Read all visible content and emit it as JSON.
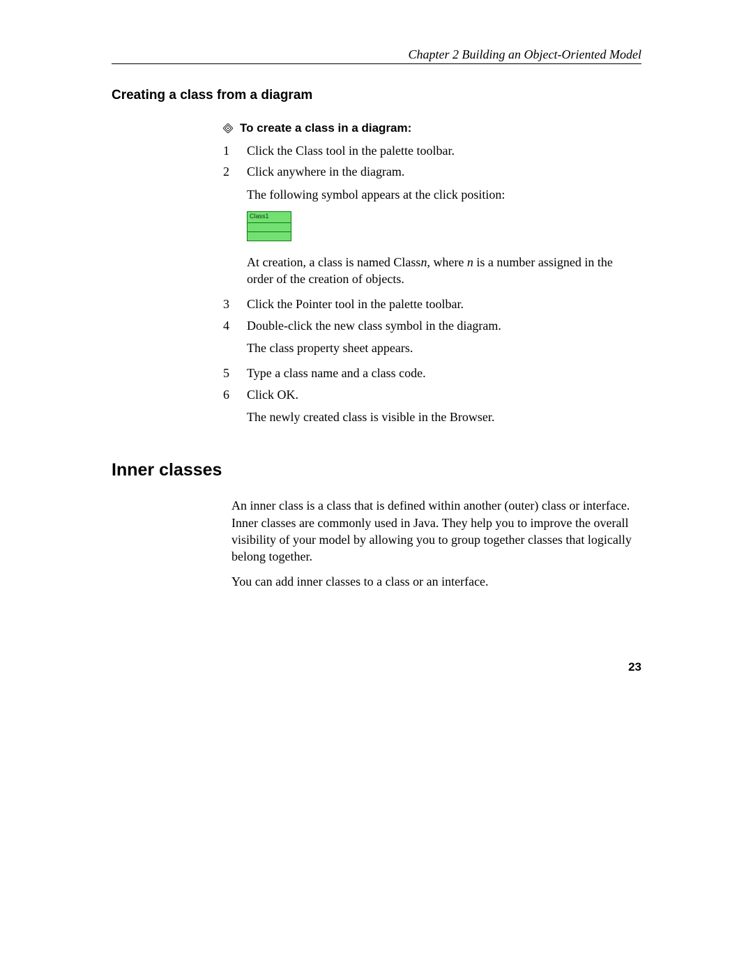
{
  "header": "Chapter 2  Building an Object-Oriented Model",
  "section_heading": "Creating a class from a diagram",
  "proc_title": "To create a class in a diagram:",
  "steps": {
    "s1": {
      "num": "1",
      "text": "Click the Class tool in the palette toolbar."
    },
    "s2": {
      "num": "2",
      "text": "Click anywhere in the diagram."
    },
    "s2_note1": "The following symbol appears at the click position:",
    "class_label": "Class1",
    "s2_note2_a": "At creation, a class is named Class",
    "s2_note2_b": "n",
    "s2_note2_c": ", where ",
    "s2_note2_d": "n",
    "s2_note2_e": " is a number assigned in the order of the creation of objects.",
    "s3": {
      "num": "3",
      "text": "Click the Pointer tool in the palette toolbar."
    },
    "s4": {
      "num": "4",
      "text": "Double-click the new class symbol in the diagram."
    },
    "s4_note": "The class property sheet appears.",
    "s5": {
      "num": "5",
      "text": "Type a class name and a class code."
    },
    "s6": {
      "num": "6",
      "text": "Click OK."
    },
    "s6_note": "The newly created class is visible in the Browser."
  },
  "h2": "Inner classes",
  "inner_para1": "An inner class is a class that is defined within another (outer) class or interface. Inner classes are commonly used in Java. They help you to improve the overall visibility of your model by allowing you to group together classes that logically belong together.",
  "inner_para2": "You can add inner classes to a class or an interface.",
  "page_number": "23"
}
